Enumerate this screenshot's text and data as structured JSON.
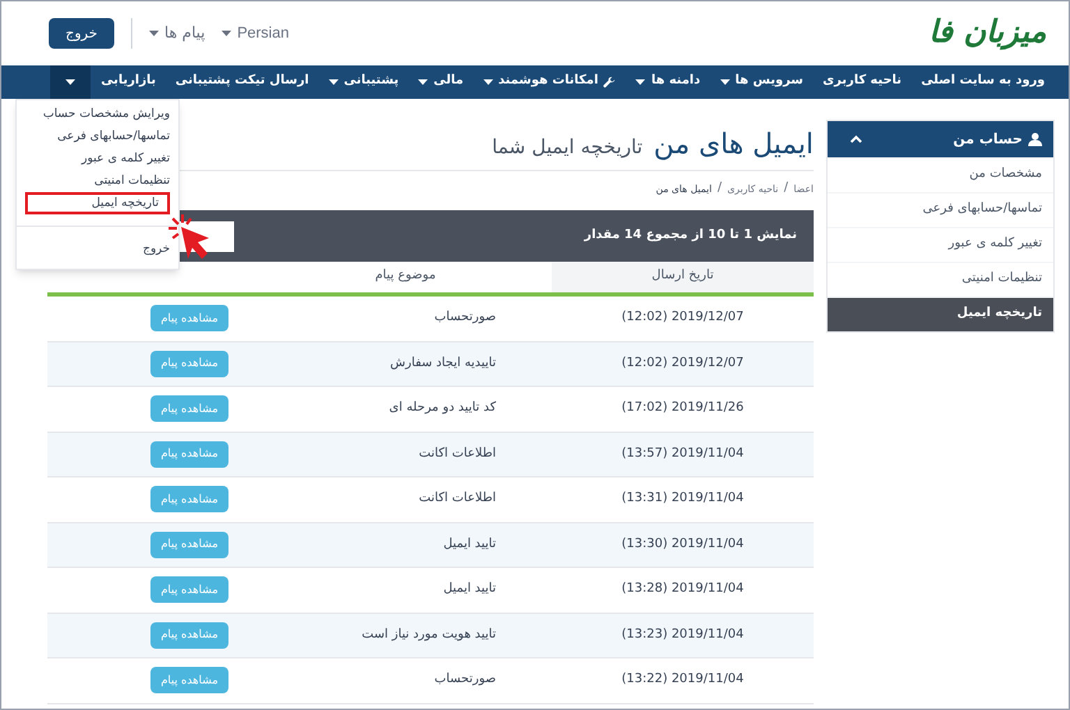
{
  "logo": {
    "text": "میزبان فا"
  },
  "header": {
    "language": "Persian",
    "messages": "پیام ها",
    "logout": "خروج"
  },
  "nav": {
    "items": [
      {
        "label": "ورود به سایت اصلی",
        "has_caret": false,
        "has_icon": false
      },
      {
        "label": "ناحیه کاربری",
        "has_caret": false,
        "has_icon": false
      },
      {
        "label": "سرویس ها",
        "has_caret": true,
        "has_icon": false
      },
      {
        "label": "دامنه ها",
        "has_caret": true,
        "has_icon": false
      },
      {
        "label": "امکانات هوشمند",
        "has_caret": true,
        "has_icon": true
      },
      {
        "label": "مالی",
        "has_caret": true,
        "has_icon": false
      },
      {
        "label": "پشتیبانی",
        "has_caret": true,
        "has_icon": false
      },
      {
        "label": "ارسال تیکت پشتیبانی",
        "has_caret": false,
        "has_icon": false
      },
      {
        "label": "بازاریابی",
        "has_caret": false,
        "has_icon": false
      }
    ],
    "menu_toggle": {
      "open": true
    }
  },
  "account_menu": {
    "items": [
      {
        "label": "ویرایش مشخصات حساب",
        "selected": false
      },
      {
        "label": "تماسها/حسابهای فرعی",
        "selected": false
      },
      {
        "label": "تغییر کلمه ی عبور",
        "selected": false
      },
      {
        "label": "تنظیمات امنیتی",
        "selected": false
      },
      {
        "label": "تاریخچه ایمیل",
        "selected": true
      }
    ],
    "logout": "خروج"
  },
  "sidebar": {
    "title": "حساب من",
    "expanded": true,
    "items": [
      {
        "label": "مشخصات من",
        "selected": false
      },
      {
        "label": "تماسها/حسابهای فرعی",
        "selected": false
      },
      {
        "label": "تغییر کلمه ی عبور",
        "selected": false
      },
      {
        "label": "تنظیمات امنیتی",
        "selected": false
      },
      {
        "label": "تاریخچه ایمیل",
        "selected": true
      }
    ]
  },
  "page": {
    "title": "ایمیل های من",
    "subtitle": "تاریخچه ایمیل شما",
    "breadcrumb": [
      "اعضا",
      "ناحیه کاربری",
      "ایمیل های من"
    ],
    "breadcrumb_separator": "/"
  },
  "table": {
    "summary": "نمایش 1 تا 10 از مجموع 14 مقدار",
    "columns": [
      {
        "label": "تاریخ ارسال",
        "sorted": true
      },
      {
        "label": "موضوع پیام",
        "sorted": false
      }
    ],
    "rows": [
      {
        "date": "(12:02) 2019/12/07",
        "subject": "صورتحساب",
        "action": "مشاهده پیام"
      },
      {
        "date": "(12:02) 2019/12/07",
        "subject": "تاییدیه ایجاد سفارش",
        "action": "مشاهده پیام"
      },
      {
        "date": "(17:02) 2019/11/26",
        "subject": "کد تایید دو مرحله ای",
        "action": "مشاهده پیام"
      },
      {
        "date": "(13:57) 2019/11/04",
        "subject": "اطلاعات اکانت",
        "action": "مشاهده پیام"
      },
      {
        "date": "(13:31) 2019/11/04",
        "subject": "اطلاعات اکانت",
        "action": "مشاهده پیام"
      },
      {
        "date": "(13:30) 2019/11/04",
        "subject": "تایید ایمیل",
        "action": "مشاهده پیام"
      },
      {
        "date": "(13:28) 2019/11/04",
        "subject": "تایید ایمیل",
        "action": "مشاهده پیام"
      },
      {
        "date": "(13:23) 2019/11/04",
        "subject": "تایید هویت مورد نیاز است",
        "action": "مشاهده پیام"
      },
      {
        "date": "(13:22) 2019/11/04",
        "subject": "صورتحساب",
        "action": "مشاهده پیام"
      }
    ]
  }
}
